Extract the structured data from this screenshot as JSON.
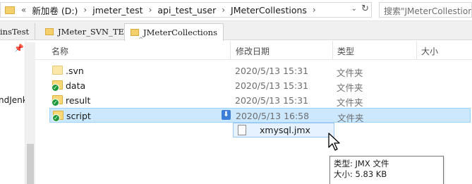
{
  "address": {
    "breadcrumbs": [
      "新加卷 (D:)",
      "jmeter_test",
      "api_test_user",
      "JMeterCollestions"
    ],
    "overflow_chevron": "«",
    "separator": "›",
    "dropdown": "⌄",
    "refresh": "↻"
  },
  "search": {
    "placeholder": "搜索\"JMeterCollestions\""
  },
  "tabs": [
    {
      "label": "insTest",
      "active": false
    },
    {
      "label": "JMeter_SVN_TEST",
      "active": false
    },
    {
      "label": "JMeterCollections",
      "active": true
    }
  ],
  "nav": {
    "pin": "📌",
    "partial_item": "ndJenk"
  },
  "columns": {
    "name": "名称",
    "modified": "修改日期",
    "type": "类型",
    "size": "大小",
    "sort_glyph": "^"
  },
  "files": [
    {
      "name": ".svn",
      "modified": "2020/5/13 15:31",
      "type": "文件夹",
      "badge": ""
    },
    {
      "name": "data",
      "modified": "2020/5/13 15:31",
      "type": "文件夹",
      "badge": "✓"
    },
    {
      "name": "result",
      "modified": "2020/5/13 15:31",
      "type": "文件夹",
      "badge": "✓"
    },
    {
      "name": "script",
      "modified": "2020/5/13 16:58",
      "type": "文件夹",
      "badge": "✓"
    }
  ],
  "drag": {
    "filename": "xmysql.jmx",
    "drop_glyph": "⬇"
  },
  "tooltip": {
    "type_line": "类型: JMX 文件",
    "size_line": "大小: 5.83 KB"
  },
  "colors": {
    "selection": "#cce8ff",
    "selection_border": "#99d1ff",
    "svn_badge": "#1f9a3a",
    "folder": "#f8d775"
  }
}
